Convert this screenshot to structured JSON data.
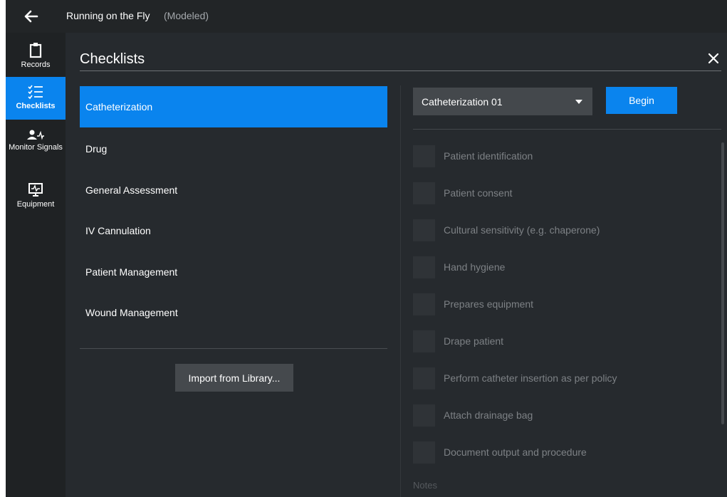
{
  "header": {
    "title": "Running on the Fly",
    "subtitle": "(Modeled)"
  },
  "sidebar": {
    "items": [
      {
        "label": "Records",
        "icon": "clipboard-icon"
      },
      {
        "label": "Checklists",
        "icon": "checklist-icon",
        "active": true
      },
      {
        "label": "Monitor Signals",
        "icon": "patient-signal-icon"
      },
      {
        "label": "Equipment",
        "icon": "monitor-icon"
      }
    ]
  },
  "panel": {
    "title": "Checklists"
  },
  "checklists": {
    "items": [
      {
        "label": "Catheterization",
        "active": true
      },
      {
        "label": "Drug"
      },
      {
        "label": "General Assessment"
      },
      {
        "label": "IV Cannulation"
      },
      {
        "label": "Patient Management"
      },
      {
        "label": "Wound Management"
      }
    ],
    "import_label": "Import from Library..."
  },
  "detail": {
    "selected": "Catheterization 01",
    "begin_label": "Begin",
    "tasks": [
      "Patient identification",
      "Patient consent",
      "Cultural sensitivity (e.g. chaperone)",
      "Hand hygiene",
      "Prepares equipment",
      "Drape patient",
      "Perform catheter insertion as per policy",
      "Attach drainage bag",
      "Document output and procedure"
    ],
    "notes_label": "Notes"
  },
  "colors": {
    "accent": "#0a84ee",
    "background": "#262a2e",
    "sidebar": "#1f2224"
  }
}
